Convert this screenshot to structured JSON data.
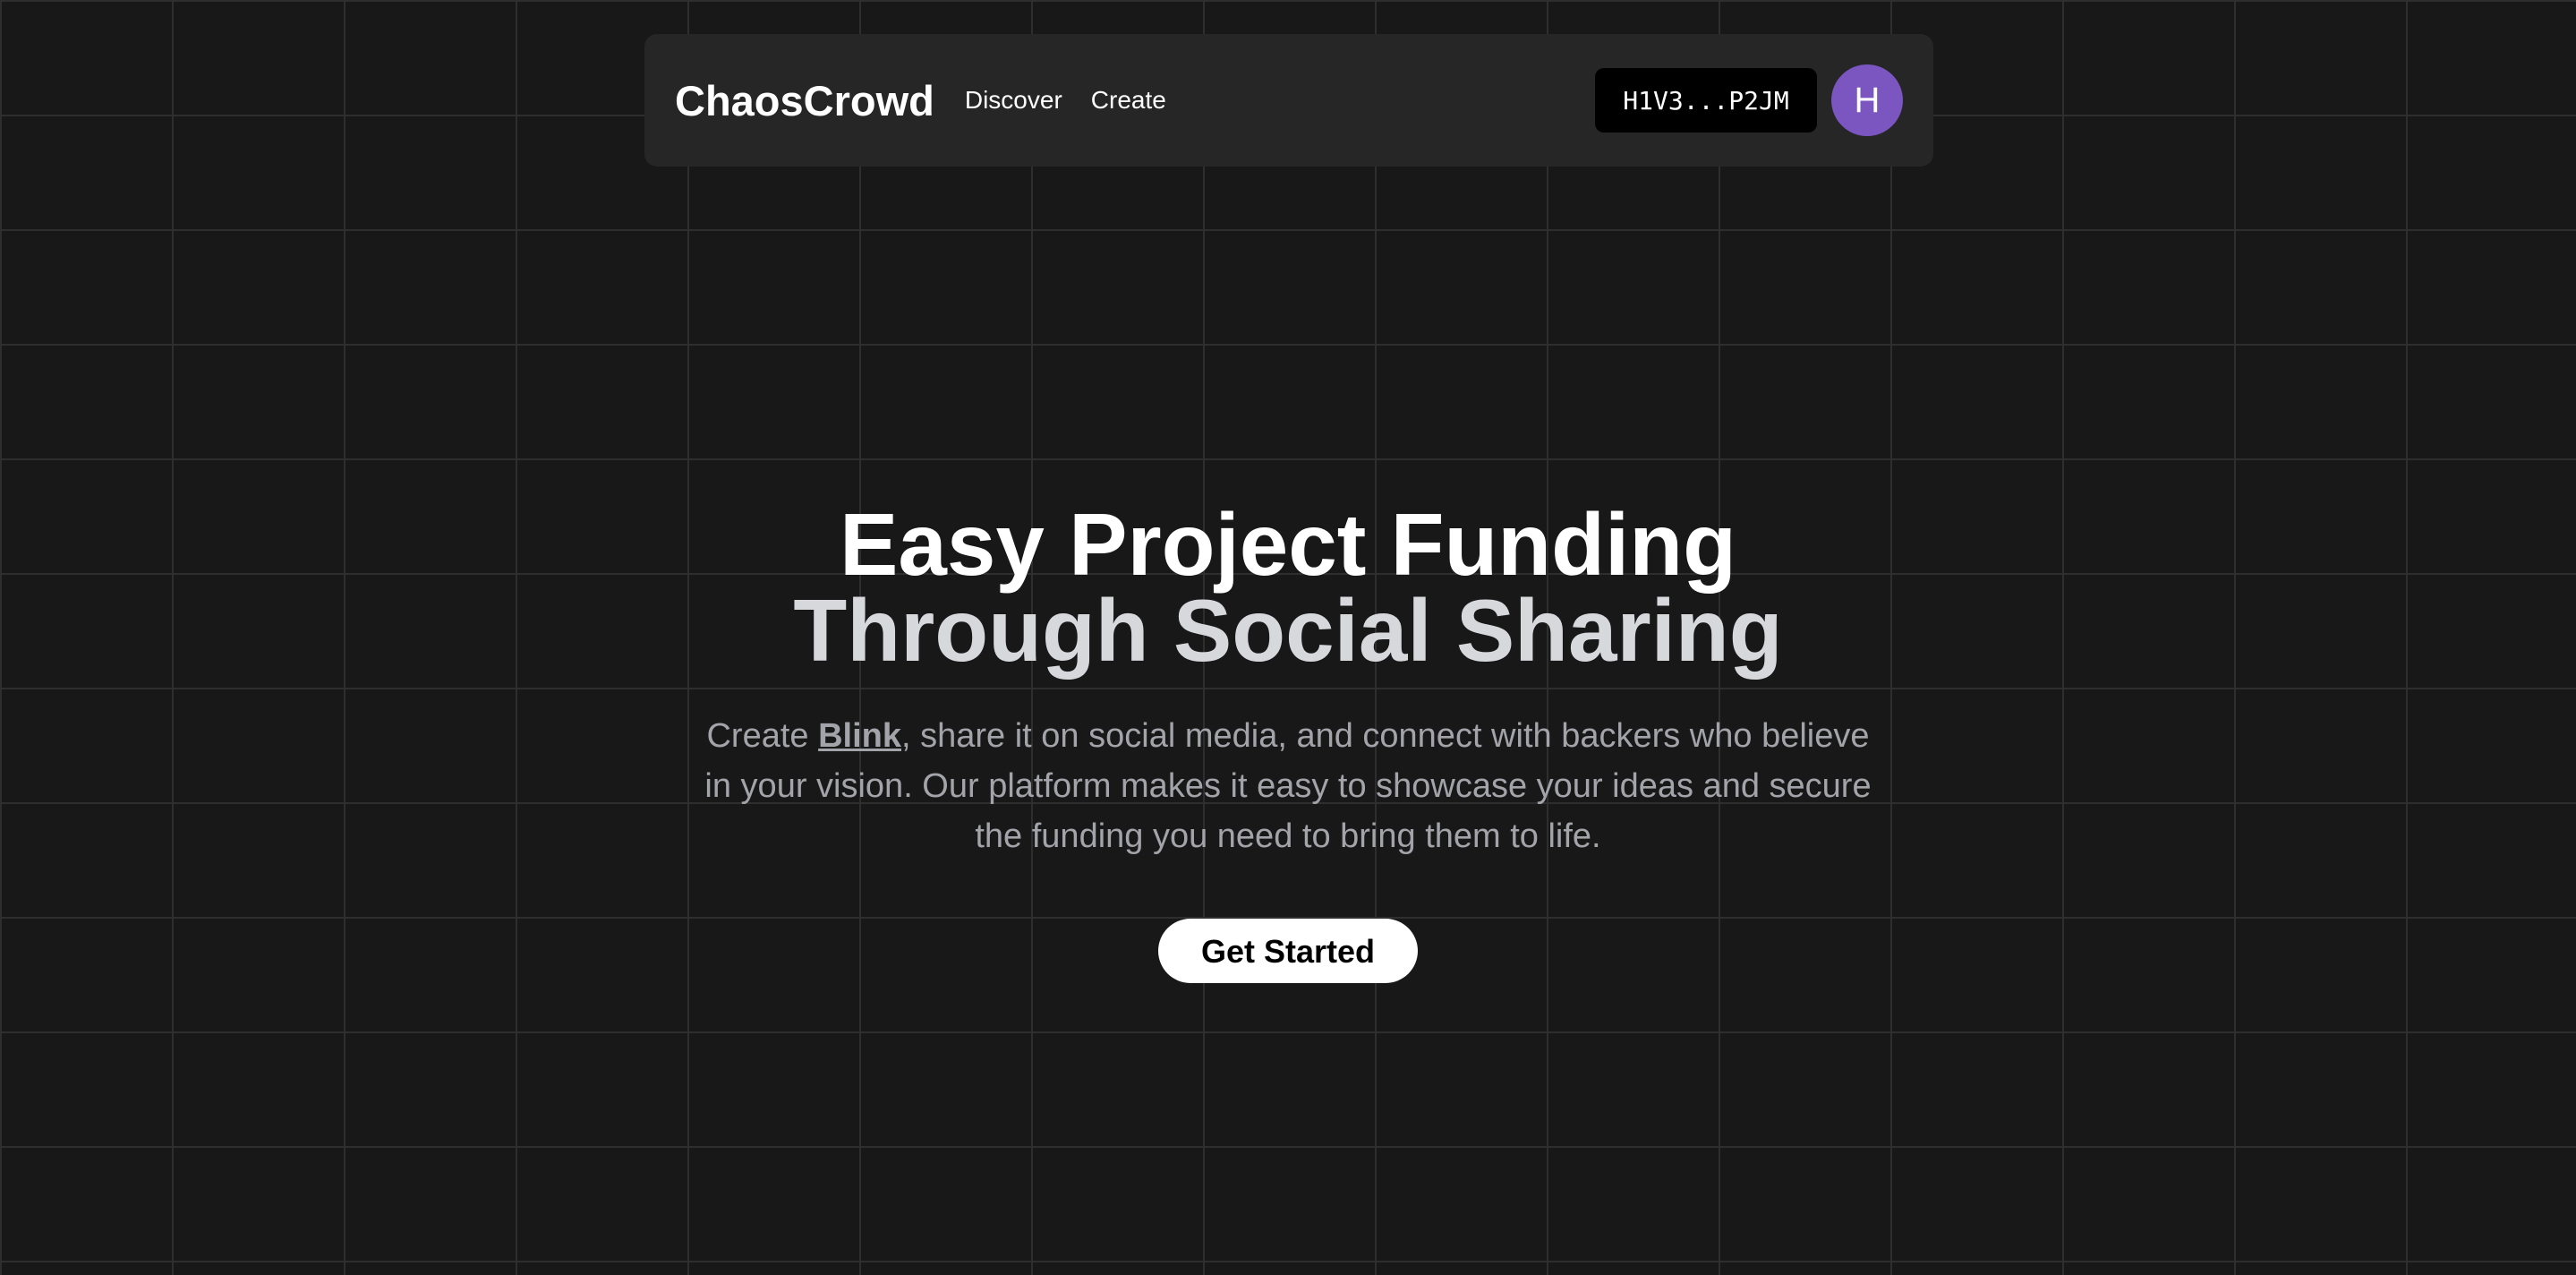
{
  "nav": {
    "brand": "ChaosCrowd",
    "links": [
      {
        "label": "Discover"
      },
      {
        "label": "Create"
      }
    ],
    "wallet_address": "H1V3...P2JM",
    "avatar_initial": "H"
  },
  "hero": {
    "headline_line1": "Easy Project Funding",
    "headline_line2": "Through Social Sharing",
    "desc_prefix": "Create ",
    "desc_link": "Blink",
    "desc_suffix": ", share it on social media, and connect with backers who believe in your vision. Our platform makes it easy to showcase your ideas and secure the funding you need to bring them to life.",
    "cta_label": "Get Started"
  },
  "colors": {
    "background": "#181818",
    "navbar": "#262626",
    "avatar": "#7b55c0",
    "muted_text": "#a3a4a9"
  }
}
